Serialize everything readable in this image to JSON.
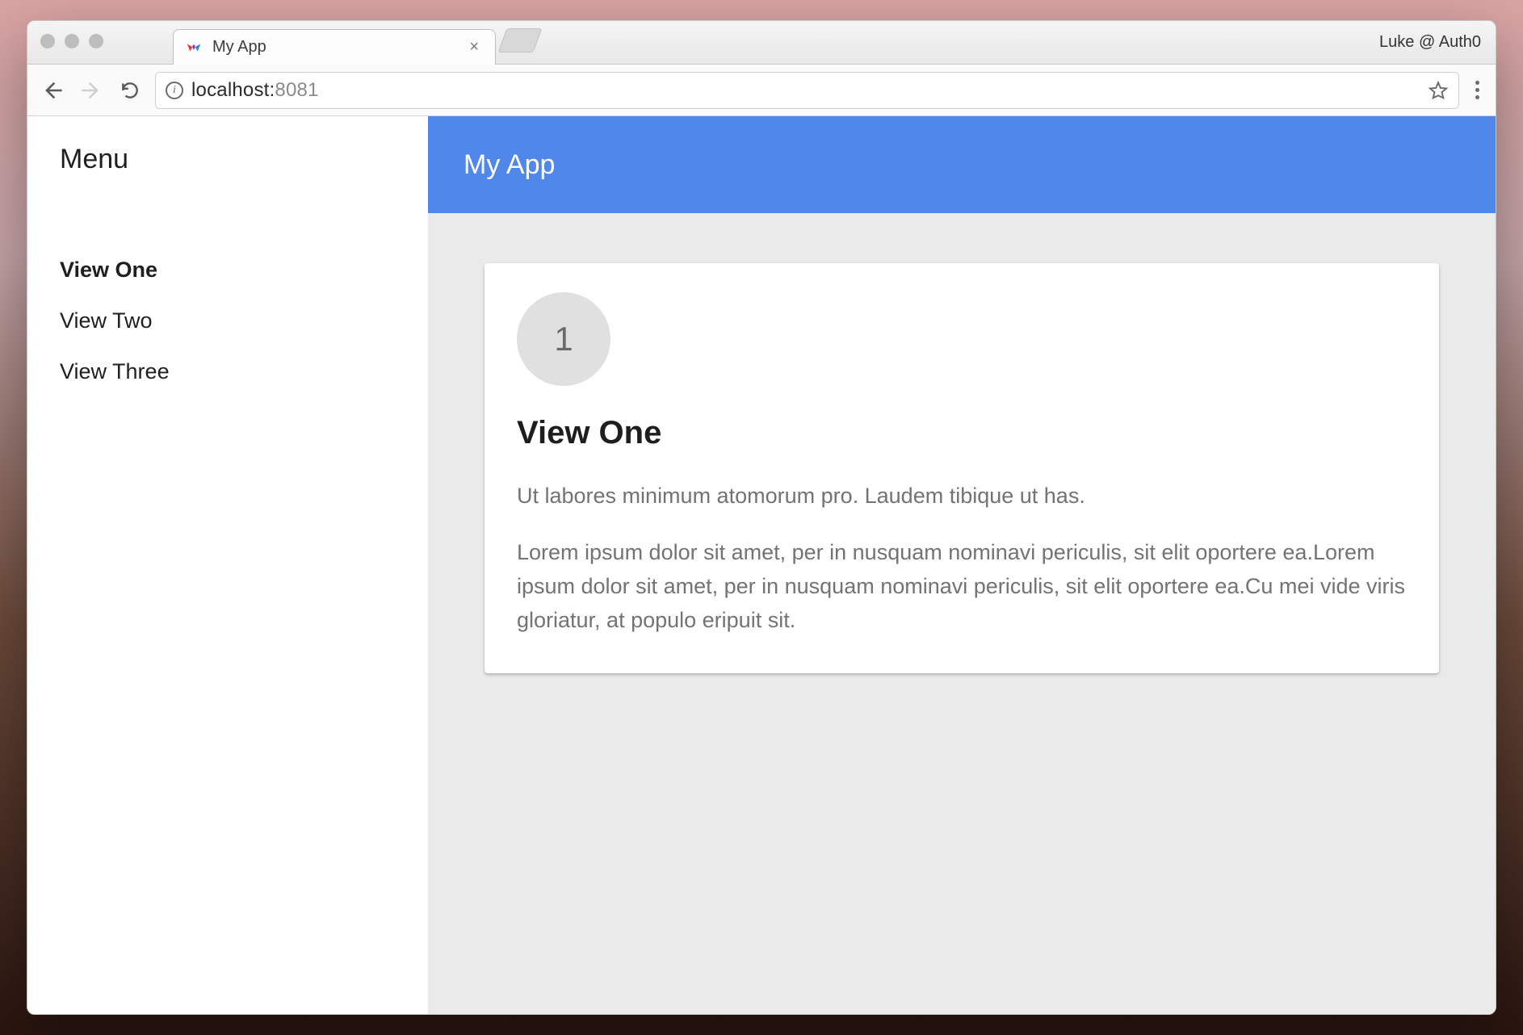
{
  "browser": {
    "tab_title": "My App",
    "profile_label": "Luke @ Auth0",
    "url_host": "localhost:",
    "url_port": "8081"
  },
  "drawer": {
    "title": "Menu",
    "items": [
      {
        "label": "View One",
        "active": true
      },
      {
        "label": "View Two",
        "active": false
      },
      {
        "label": "View Three",
        "active": false
      }
    ]
  },
  "appbar": {
    "title": "My App"
  },
  "card": {
    "badge": "1",
    "title": "View One",
    "subtitle": "Ut labores minimum atomorum pro. Laudem tibique ut has.",
    "body": "Lorem ipsum dolor sit amet, per in nusquam nominavi periculis, sit elit oportere ea.Lorem ipsum dolor sit amet, per in nusquam nominavi periculis, sit elit oportere ea.Cu mei vide viris gloriatur, at populo eripuit sit."
  }
}
